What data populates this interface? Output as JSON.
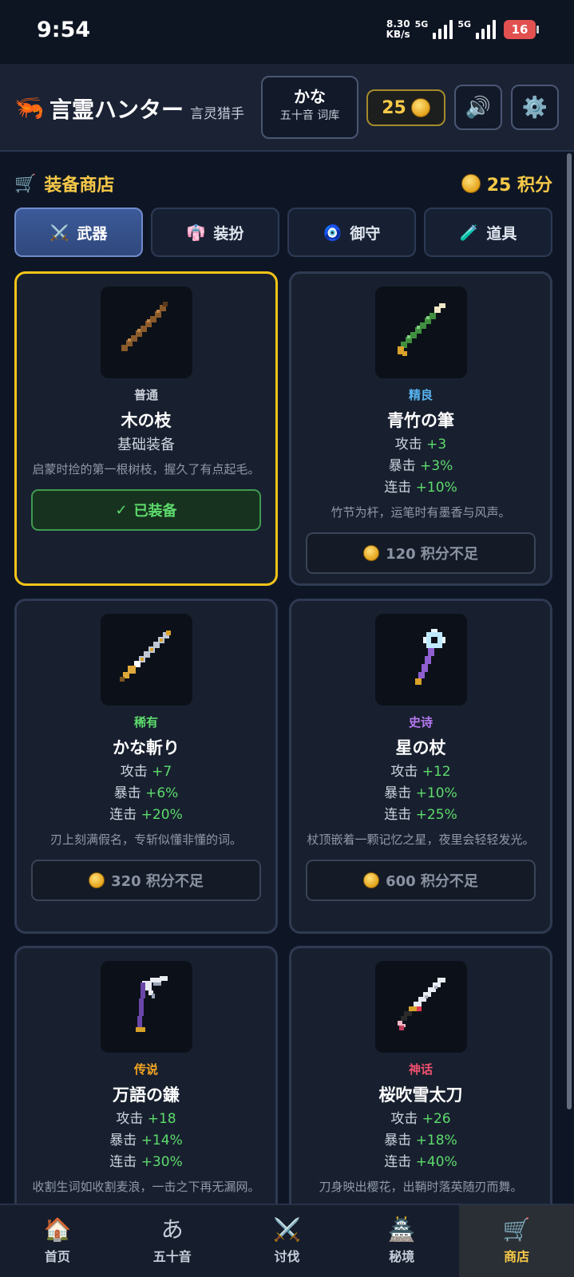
{
  "status": {
    "time": "9:54",
    "net_speed_value": "8.30",
    "net_speed_unit": "KB/s",
    "sig1": "5G",
    "sig2": "5G",
    "battery": "16"
  },
  "header": {
    "logo_icon": "🦐",
    "title": "言霊ハンター",
    "subtitle": "言灵猎手",
    "library_title": "かな",
    "library_sub": "五十音 词库",
    "points": "25",
    "sound_icon": "🔊",
    "settings_icon": "⚙️"
  },
  "shop": {
    "cart_icon": "🛒",
    "title": "装备商店",
    "points_label": "25 积分"
  },
  "tabs": [
    {
      "icon": "⚔️",
      "label": "武器",
      "active": true
    },
    {
      "icon": "👘",
      "label": "装扮",
      "active": false
    },
    {
      "icon": "🧿",
      "label": "御守",
      "active": false
    },
    {
      "icon": "🧪",
      "label": "道具",
      "active": false
    }
  ],
  "items": [
    {
      "rarity": "普通",
      "rarity_color": "#c9ced8",
      "name": "木の枝",
      "base_label": "基础装备",
      "desc": "启蒙时捡的第一根树枝，握久了有点起毛。",
      "button": "已装备",
      "state": "equipped"
    },
    {
      "rarity": "精良",
      "rarity_color": "#58b4f0",
      "name": "青竹の筆",
      "stats": [
        {
          "label": "攻击",
          "value": "+3"
        },
        {
          "label": "暴击",
          "value": "+3%"
        },
        {
          "label": "连击",
          "value": "+10%"
        }
      ],
      "desc": "竹节为杆，运笔时有墨香与风声。",
      "button": "120 积分不足",
      "state": "locked"
    },
    {
      "rarity": "稀有",
      "rarity_color": "#5ddb6c",
      "name": "かな斬り",
      "stats": [
        {
          "label": "攻击",
          "value": "+7"
        },
        {
          "label": "暴击",
          "value": "+6%"
        },
        {
          "label": "连击",
          "value": "+20%"
        }
      ],
      "desc": "刃上刻满假名，专斩似懂非懂的词。",
      "button": "320 积分不足",
      "state": "locked"
    },
    {
      "rarity": "史诗",
      "rarity_color": "#b779f2",
      "name": "星の杖",
      "stats": [
        {
          "label": "攻击",
          "value": "+12"
        },
        {
          "label": "暴击",
          "value": "+10%"
        },
        {
          "label": "连击",
          "value": "+25%"
        }
      ],
      "desc": "杖顶嵌着一颗记忆之星，夜里会轻轻发光。",
      "button": "600 积分不足",
      "state": "locked"
    },
    {
      "rarity": "传说",
      "rarity_color": "#f5a623",
      "name": "万語の鎌",
      "stats": [
        {
          "label": "攻击",
          "value": "+18"
        },
        {
          "label": "暴击",
          "value": "+14%"
        },
        {
          "label": "连击",
          "value": "+30%"
        }
      ],
      "desc": "收割生词如收割麦浪，一击之下再无漏网。"
    },
    {
      "rarity": "神话",
      "rarity_color": "#f0506e",
      "name": "桜吹雪太刀",
      "stats": [
        {
          "label": "攻击",
          "value": "+26"
        },
        {
          "label": "暴击",
          "value": "+18%"
        },
        {
          "label": "连击",
          "value": "+40%"
        }
      ],
      "desc": "刀身映出樱花，出鞘时落英随刃而舞。"
    }
  ],
  "nav": [
    {
      "icon": "🏠",
      "label": "首页",
      "active": false
    },
    {
      "icon": "あ",
      "label": "五十音",
      "active": false
    },
    {
      "icon": "⚔️",
      "label": "讨伐",
      "active": false
    },
    {
      "icon": "🏯",
      "label": "秘境",
      "active": false
    },
    {
      "icon": "🛒",
      "label": "商店",
      "active": true
    }
  ]
}
